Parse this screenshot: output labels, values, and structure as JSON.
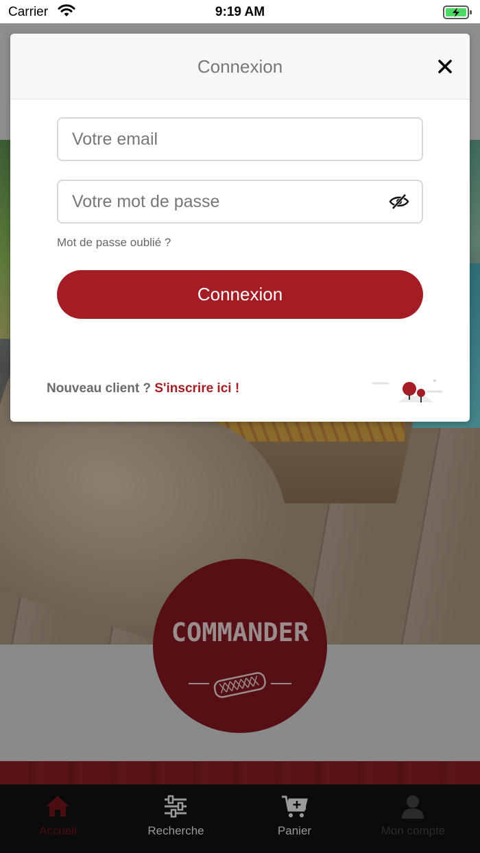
{
  "status_bar": {
    "carrier": "Carrier",
    "time": "9:19 AM"
  },
  "background": {
    "order_button_label": "COMMANDER"
  },
  "tab_bar": {
    "items": [
      {
        "label": "Accueil",
        "icon": "home-icon"
      },
      {
        "label": "Recherche",
        "icon": "sliders-icon"
      },
      {
        "label": "Panier",
        "icon": "cart-add-icon"
      },
      {
        "label": "Mon compte",
        "icon": "user-icon"
      }
    ],
    "active": "Accueil"
  },
  "login_modal": {
    "title": "Connexion",
    "email_placeholder": "Votre email",
    "email_value": "",
    "password_placeholder": "Votre mot de passe",
    "password_value": "",
    "forgot_password": "Mot de passe oublié ?",
    "submit_label": "Connexion",
    "signup_prompt": "Nouveau client ?",
    "signup_link": "S'inscrire ici !"
  },
  "colors": {
    "accent": "#a51d24",
    "order_badge": "#560f14",
    "tab_bar": "#0b0b0b"
  }
}
